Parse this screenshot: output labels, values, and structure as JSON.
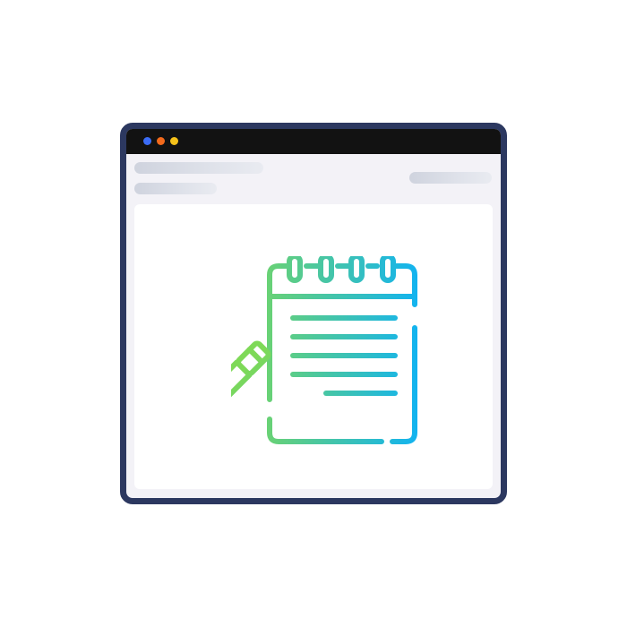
{
  "window": {
    "frame_color": "#2c3860",
    "titlebar_color": "#121212",
    "background_color": "#f3f2f7",
    "controls": [
      {
        "name": "window-dot-blue",
        "color": "#3b6cf6"
      },
      {
        "name": "window-dot-orange",
        "color": "#f36a1c"
      },
      {
        "name": "window-dot-yellow",
        "color": "#f6c21a"
      }
    ]
  },
  "header": {
    "placeholders": [
      "title-skeleton",
      "subtitle-skeleton",
      "action-skeleton"
    ]
  },
  "main": {
    "illustration": {
      "icon": "notepad-with-pencil-icon",
      "gradient": [
        "#7ed957",
        "#12b3f0"
      ]
    }
  }
}
